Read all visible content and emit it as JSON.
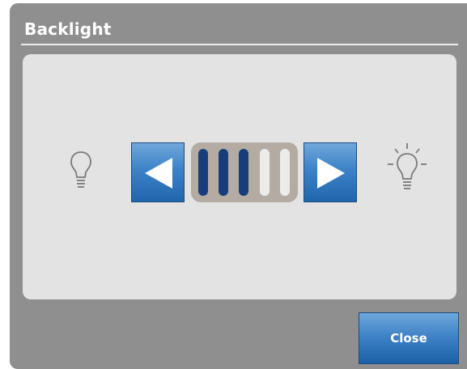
{
  "dialog": {
    "title": "Backlight"
  },
  "backlight": {
    "level": 3,
    "max": 5
  },
  "buttons": {
    "close_label": "Close"
  },
  "icons": {
    "dim": "lightbulb-off-icon",
    "bright": "lightbulb-on-icon",
    "decrease": "arrow-left-icon",
    "increase": "arrow-right-icon"
  },
  "colors": {
    "dialog_bg": "#8f8f8f",
    "panel_bg": "#e3e3e3",
    "segment_on": "#173e7a",
    "segment_off": "#ececec",
    "button_blue": "#3c82c7"
  }
}
